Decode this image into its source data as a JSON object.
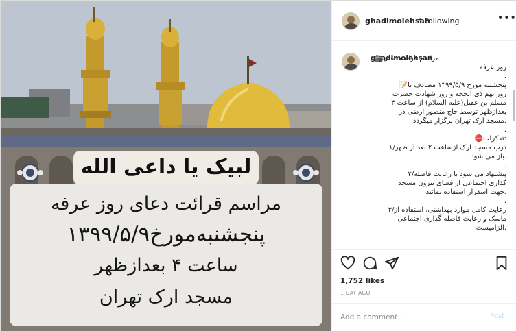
{
  "post": {
    "overlay": {
      "title": "لبیک یا داعی الله",
      "line1": "مراسم قرائت دعای روز عرفه",
      "line2": "پنجشنبه‌مورخ۱۳۹۹/۵/۹",
      "line3": "ساعت ۴ بعدازظهر",
      "line4": "مسجد ارک تهران"
    }
  },
  "header": {
    "username": "ghadimolehsan",
    "separator": "•",
    "follow_status": "Following",
    "more_icon": "ellipsis-icon"
  },
  "caption": {
    "username": "ghadimolehsan",
    "lines": [
      "مراسم قرائت دعای🕋",
      "روز عرفه",
      ".",
      "پنجشنبه مورخ ۱۳۹۹/۵/۹ مصادف با📝",
      "روز نهم ذی الحجه و روز شهادت حضرت",
      "مسلم بن عقیل(علیه السلام) از ساعت ۴",
      "بعدازظهر توسط حاج منصور ارضی در",
      ".مسجد ارک تهران برگزار میگردد",
      ".",
      ":تذکرات⛔",
      "درب مسجد ارک ازساعت ۲ بعد از ظهر/۱",
      ".باز می شود",
      ".",
      "پیشنهاد می شود با رعایت فاصله/۲",
      "گذاری اجتماعی از فضای بیرون مسجد",
      ".جهت اسقرار استفاده نمائید",
      ".",
      "رعایت کامل موارد بهداشتی، استفاده از/۳",
      "ماسک و رعایت فاصله گذاری اجتماعی",
      ".الزامیست"
    ]
  },
  "actions": {
    "icons": [
      "heart-icon",
      "comment-icon",
      "share-icon",
      "bookmark-icon"
    ],
    "likes": "1,752 likes",
    "date": "1 DAY AGO"
  },
  "comment": {
    "placeholder": "Add a comment...",
    "post_label": "Post"
  },
  "colors": {
    "text": "#262626",
    "muted": "#8e8e8e",
    "post_disabled": "#b2dffc",
    "dome_gold": "#d9b23a",
    "card_bg": "#ebe9e5"
  }
}
